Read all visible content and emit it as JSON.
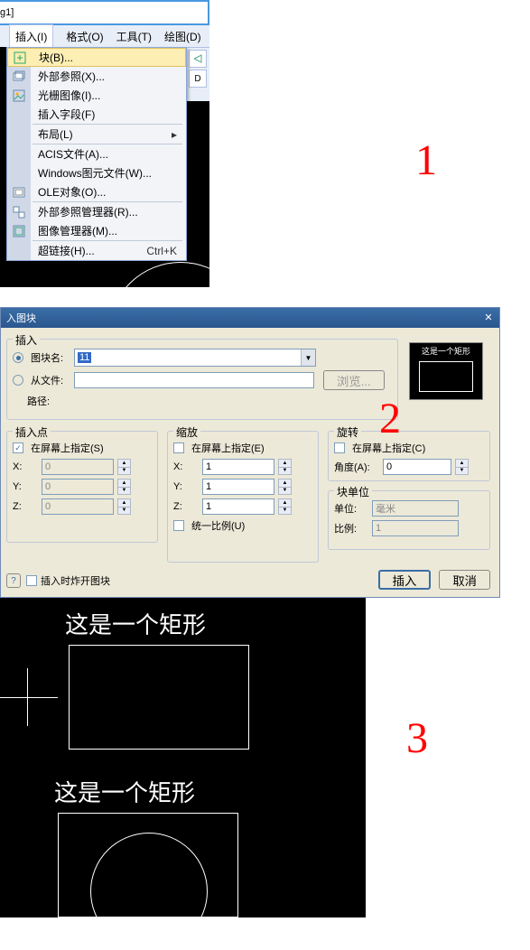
{
  "window": {
    "title_suffix": "g1]"
  },
  "menubar": {
    "insert": "插入(I)",
    "format": "格式(O)",
    "tools": "工具(T)",
    "draw": "绘图(D)"
  },
  "menu": {
    "block": "块(B)...",
    "xref": "外部参照(X)...",
    "raster": "光栅图像(I)...",
    "field": "插入字段(F)",
    "layout": "布局(L)",
    "acis": "ACIS文件(A)...",
    "wmf": "Windows图元文件(W)...",
    "ole": "OLE对象(O)...",
    "xrefmgr": "外部参照管理器(R)...",
    "imgmgr": "图像管理器(M)...",
    "hyper": "超链接(H)...",
    "hyper_sc": "Ctrl+K"
  },
  "toolbar_peek": {
    "d": "D"
  },
  "dialog": {
    "title": "入图块",
    "insert_grp": "插入",
    "blockname_lbl": "图块名:",
    "blockname_val": "11",
    "fromfile_lbl": "从文件:",
    "fromfile_val": "",
    "path_lbl": "路径:",
    "browse": "浏览...",
    "preview_txt": "这是一个矩形",
    "ipoint": {
      "title": "插入点",
      "onscreen": "在屏幕上指定(S)",
      "x": "X:",
      "y": "Y:",
      "z": "Z:",
      "xv": "0",
      "yv": "0",
      "zv": "0"
    },
    "scale": {
      "title": "缩放",
      "onscreen": "在屏幕上指定(E)",
      "x": "X:",
      "y": "Y:",
      "z": "Z:",
      "xv": "1",
      "yv": "1",
      "zv": "1",
      "uniform": "统一比例(U)"
    },
    "rotation": {
      "title": "旋转",
      "onscreen": "在屏幕上指定(C)",
      "angle": "角度(A):",
      "anglev": "0"
    },
    "bunit": {
      "title": "块单位",
      "unit": "单位:",
      "unitv": "毫米",
      "ratio": "比例:",
      "ratiov": "1"
    },
    "explode": "插入时炸开图块",
    "ok": "插入",
    "cancel": "取消"
  },
  "section3": {
    "text1": "这是一个矩形",
    "text2": "这是一个矩形"
  },
  "annotations": {
    "a1": "1",
    "a2": "2",
    "a3": "3"
  }
}
